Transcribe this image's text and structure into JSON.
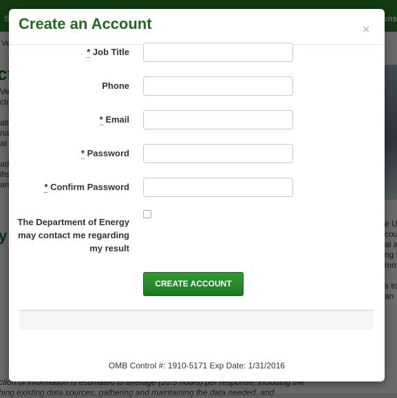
{
  "background_page": {
    "nav_left": "S",
    "nav_right": "ons",
    "breadcrumb": "Ve",
    "heading_fragment": "ct",
    "subheading_fragment": "y",
    "left_lines": [
      "Ve",
      "ctri",
      "",
      "atio",
      "na",
      "ar",
      "",
      "ad",
      "ihs",
      "ard"
    ],
    "right_lines": [
      "e U",
      "cou",
      "al a",
      "ng t",
      "mm",
      "",
      "s to",
      "an"
    ],
    "footer_lines": [
      "ction of information is estimated to average (20.5 hours) per response, including the",
      "hing existing data sources, gathering and maintaining the data needed, and"
    ]
  },
  "modal": {
    "title": "Create an Account",
    "close_symbol": "×",
    "fields": {
      "job_title": {
        "required": "*",
        "label": "Job Title",
        "value": ""
      },
      "phone": {
        "label": "Phone",
        "value": ""
      },
      "email": {
        "required": "*",
        "label": "Email",
        "value": ""
      },
      "password": {
        "required": "*",
        "label": "Password",
        "value": ""
      },
      "confirm_password": {
        "required": "*",
        "label": "Confirm Password",
        "value": ""
      }
    },
    "consent_label": "The Department of Energy may contact me regarding my result",
    "consent_checked": false,
    "submit_label": "CREATE ACCOUNT",
    "omb_text": "OMB Control #: 1910-5171 Exp Date: 1/31/2016"
  },
  "colors": {
    "brand_green": "#1f6a1e",
    "button_green": "#2f9a34",
    "nav_green": "#2e8a2c"
  }
}
